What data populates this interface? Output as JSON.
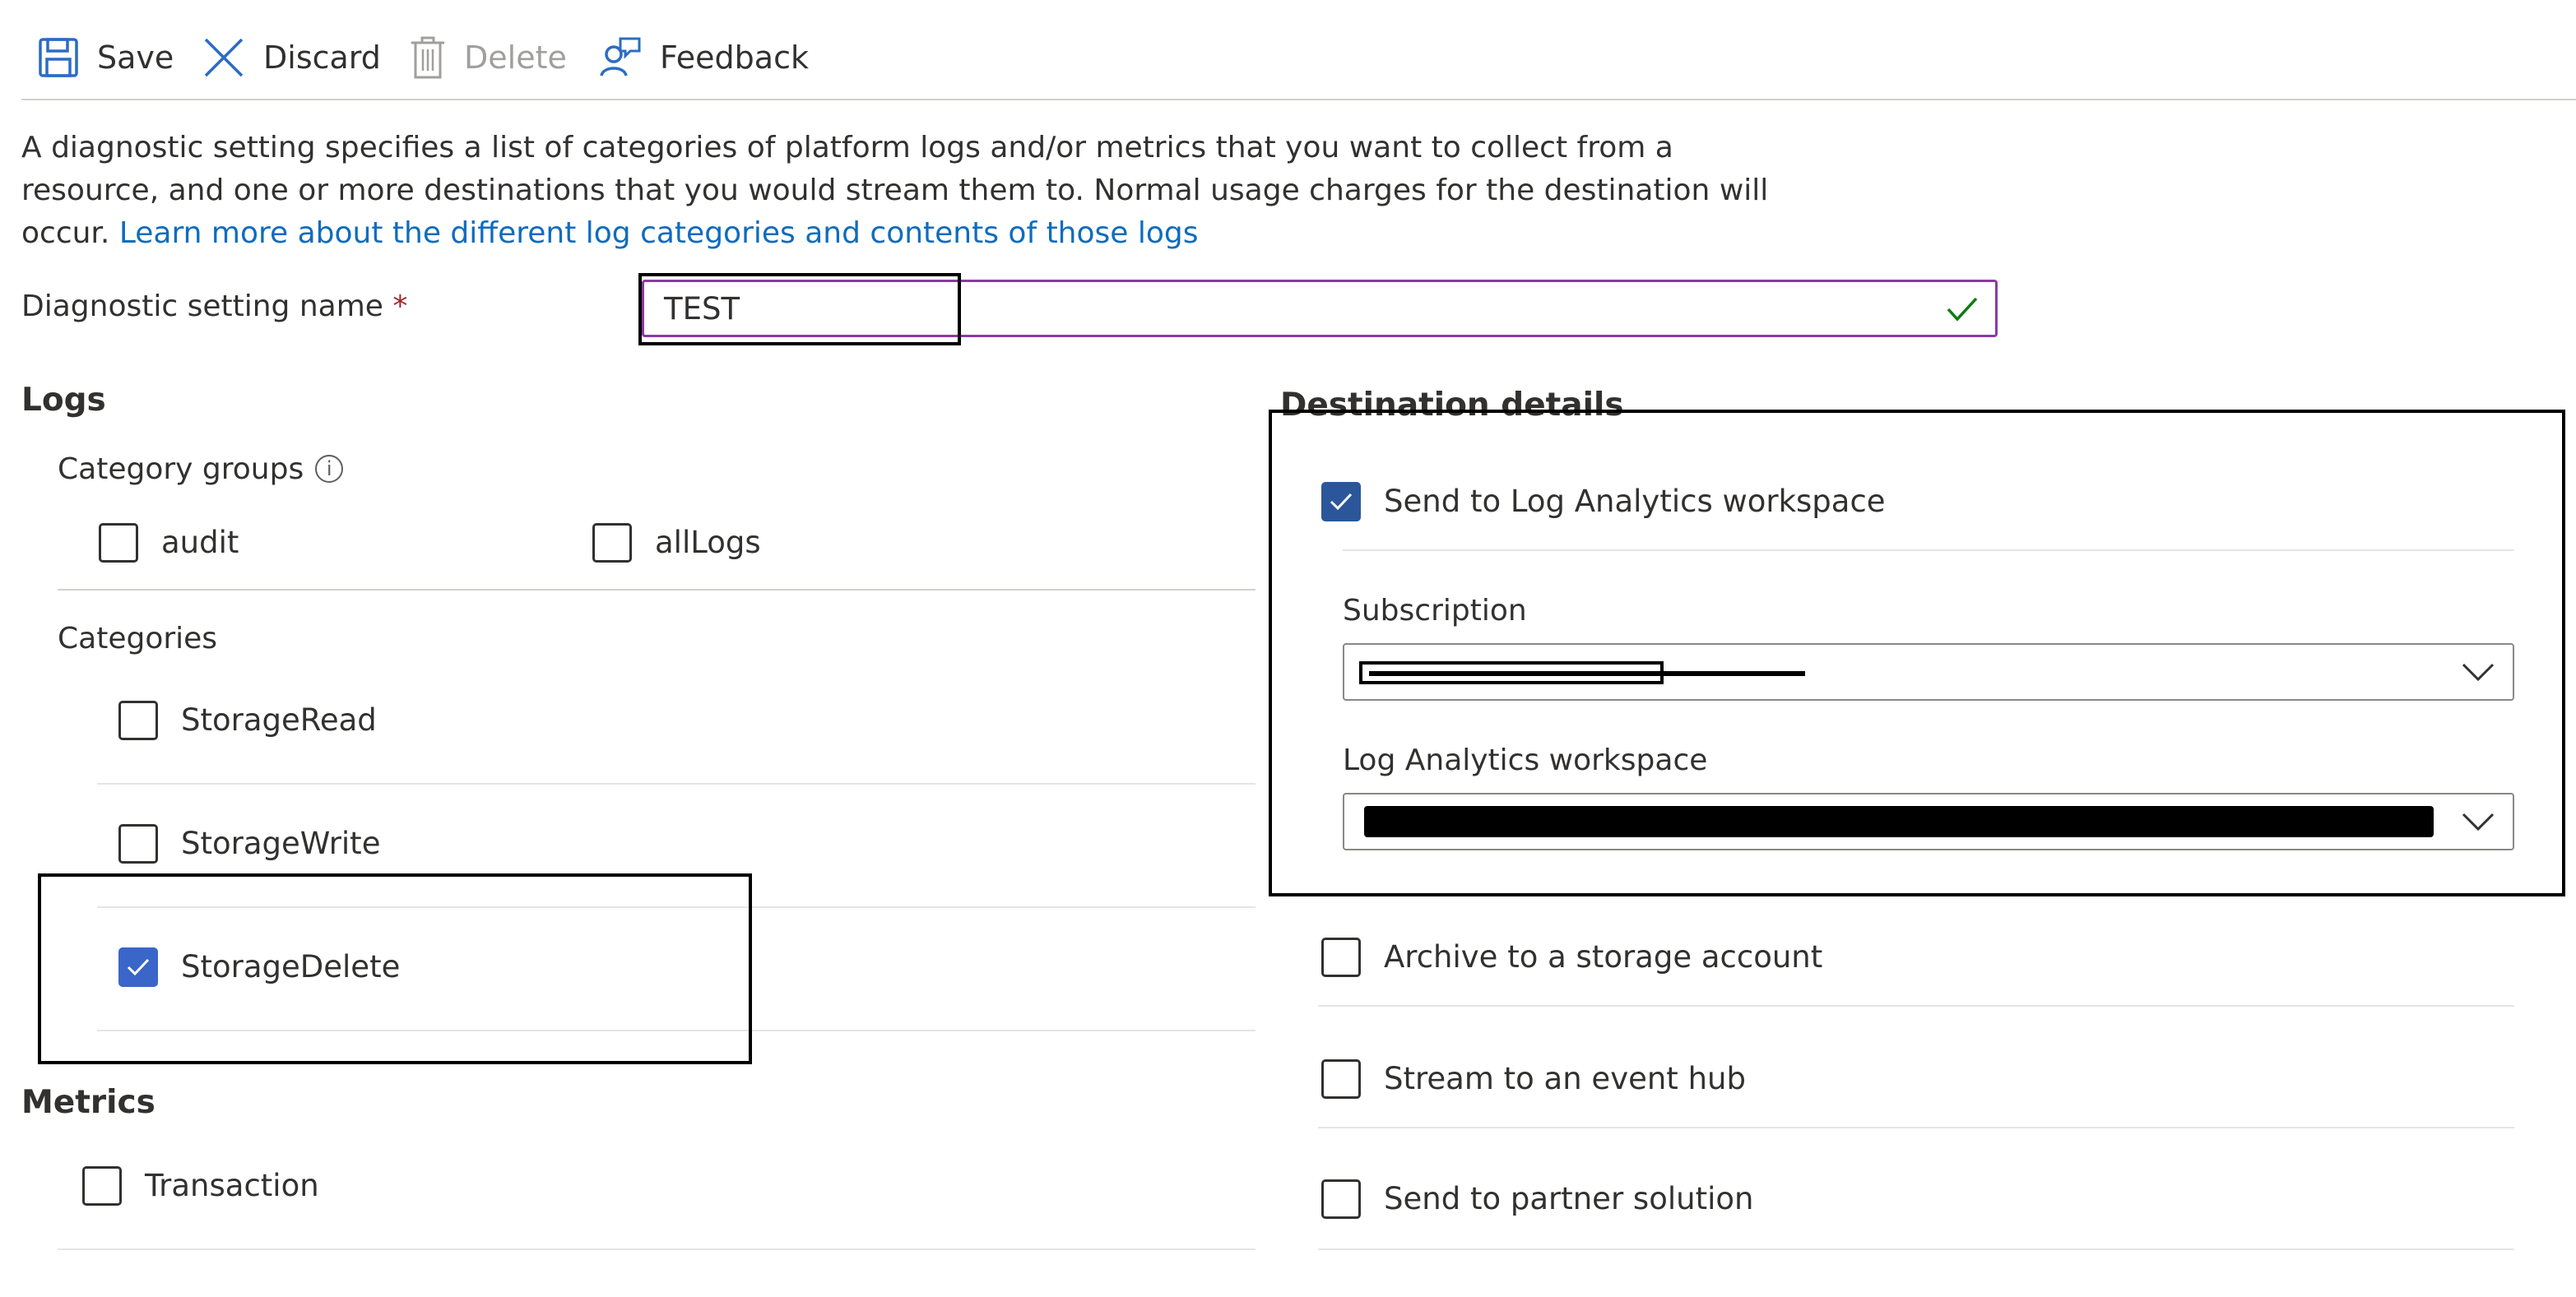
{
  "toolbar": {
    "save_label": "Save",
    "discard_label": "Discard",
    "delete_label": "Delete",
    "feedback_label": "Feedback"
  },
  "description": {
    "text": "A diagnostic setting specifies a list of categories of platform logs and/or metrics that you want to collect from a resource, and one or more destinations that you would stream them to. Normal usage charges for the destination will occur.",
    "link_text": "Learn more about the different log categories and contents of those logs"
  },
  "setting_name": {
    "label": "Diagnostic setting name",
    "required_mark": "*",
    "value": "TEST"
  },
  "logs": {
    "heading": "Logs",
    "category_groups": {
      "label": "Category groups",
      "info_glyph": "i",
      "items": [
        {
          "label": "audit",
          "checked": false
        },
        {
          "label": "allLogs",
          "checked": false
        }
      ]
    },
    "categories": {
      "label": "Categories",
      "items": [
        {
          "label": "StorageRead",
          "checked": false
        },
        {
          "label": "StorageWrite",
          "checked": false
        },
        {
          "label": "StorageDelete",
          "checked": true
        }
      ]
    }
  },
  "metrics": {
    "heading": "Metrics",
    "items": [
      {
        "label": "Transaction",
        "checked": false
      }
    ]
  },
  "destination": {
    "heading": "Destination details",
    "log_analytics": {
      "label": "Send to Log Analytics workspace",
      "checked": true,
      "subscription_label": "Subscription",
      "workspace_label": "Log Analytics workspace"
    },
    "others": [
      {
        "label": "Archive to a storage account",
        "checked": false
      },
      {
        "label": "Stream to an event hub",
        "checked": false
      },
      {
        "label": "Send to partner solution",
        "checked": false
      }
    ]
  },
  "colors": {
    "accent": "#3a66c9",
    "link": "#0f6cbd",
    "required": "#a4262c",
    "valid": "#107c10",
    "input_border": "#8a3aa8"
  }
}
